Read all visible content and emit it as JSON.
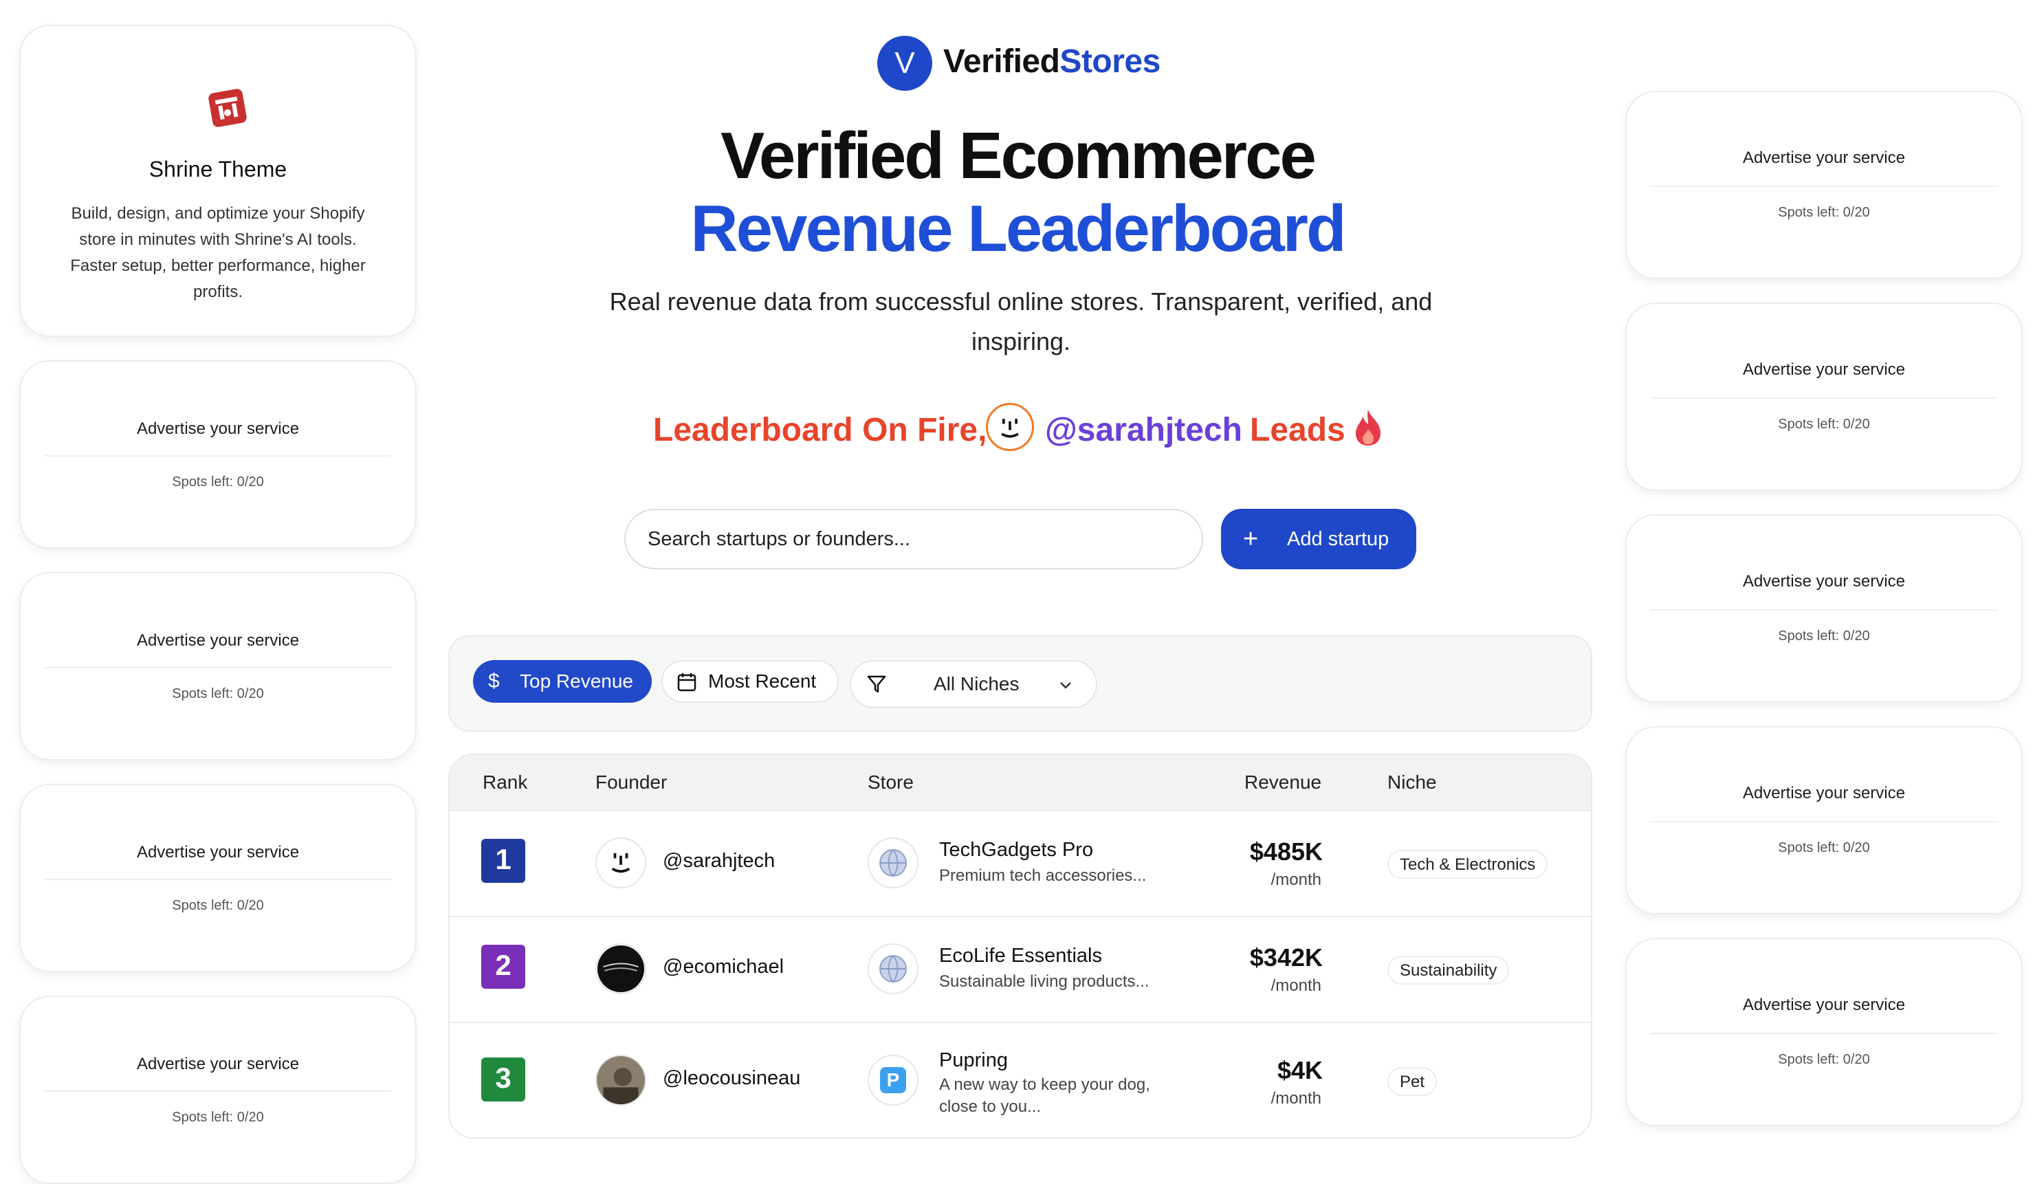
{
  "brand": {
    "name_part1": "Verified",
    "name_part2": "Stores",
    "logo_letter": "V"
  },
  "hero": {
    "title_line1": "Verified Ecommerce",
    "title_line2": "Revenue Leaderboard",
    "subtitle": "Real revenue data from successful online stores. Transparent, verified, and inspiring.",
    "fire_prefix": "Leaderboard On Fire,",
    "fire_handle": "@sarahjtech",
    "fire_suffix": "Leads"
  },
  "search": {
    "placeholder": "Search startups or founders..."
  },
  "add_button": {
    "label": "Add startup",
    "icon": "plus-icon"
  },
  "filters": {
    "top_revenue": "Top Revenue",
    "most_recent": "Most Recent",
    "niche_select": "All Niches"
  },
  "table": {
    "headers": {
      "rank": "Rank",
      "founder": "Founder",
      "store": "Store",
      "revenue": "Revenue",
      "niche": "Niche"
    },
    "rows": [
      {
        "rank": "1",
        "handle": "@sarahjtech",
        "store": "TechGadgets Pro",
        "desc": "Premium tech accessories...",
        "revenue": "$485K",
        "unit": "/month",
        "niche": "Tech & Electronics"
      },
      {
        "rank": "2",
        "handle": "@ecomichael",
        "store": "EcoLife Essentials",
        "desc": "Sustainable living products...",
        "revenue": "$342K",
        "unit": "/month",
        "niche": "Sustainability"
      },
      {
        "rank": "3",
        "handle": "@leocousineau",
        "store": "Pupring",
        "desc": "A new way to keep your dog, close to you...",
        "revenue": "$4K",
        "unit": "/month",
        "niche": "Pet"
      }
    ]
  },
  "sponsor": {
    "title": "Shrine Theme",
    "description": "Build, design, and optimize your Shopify store in minutes with Shrine's AI tools. Faster setup, better performance, higher profits."
  },
  "ad_slot": {
    "title": "Advertise your service",
    "spots": "Spots left: 0/20"
  },
  "colors": {
    "primary": "#1f47c9",
    "fire": "#e8442b",
    "handle": "#6b3fd9"
  }
}
